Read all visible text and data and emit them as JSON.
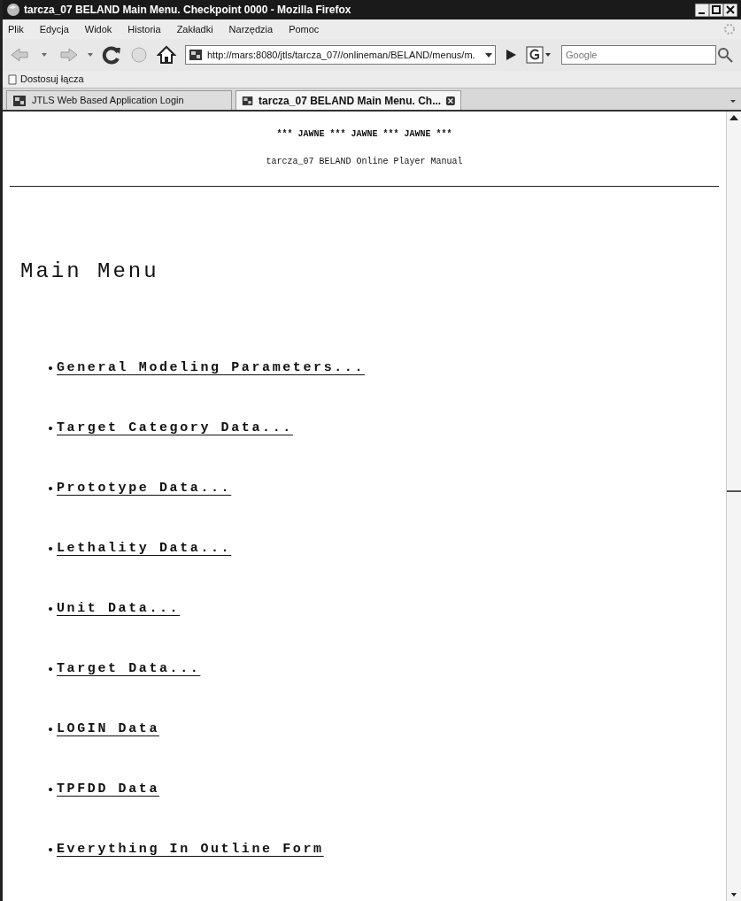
{
  "window": {
    "title": "tarcza_07 BELAND Main Menu. Checkpoint 0000 - Mozilla Firefox"
  },
  "menu": [
    "Plik",
    "Edycja",
    "Widok",
    "Historia",
    "Zakładki",
    "Narzędzia",
    "Pomoc"
  ],
  "toolbar": {
    "url": "http://mars:8080/jtls/tarcza_07//onlineman/BELAND/menus/m.",
    "search": {
      "placeholder": "Google"
    }
  },
  "bookmarks": [
    "Dostosuj łącza"
  ],
  "tabs": [
    {
      "label": "JTLS Web Based Application Login",
      "selected": false
    },
    {
      "label": "tarcza_07 BELAND Main Menu. Ch...",
      "selected": true
    }
  ],
  "page": {
    "banner": "*** JAWNE *** JAWNE *** JAWNE ***",
    "subtitle": "tarcza_07 BELAND Online Player Manual",
    "heading": "Main Menu",
    "links": [
      "General Modeling Parameters...",
      "Target Category Data...",
      "Prototype Data...",
      "Lethality Data...",
      "Unit Data...",
      "Target Data...",
      "LOGIN Data",
      "TPFDD Data",
      "Everything In Outline Form"
    ]
  }
}
